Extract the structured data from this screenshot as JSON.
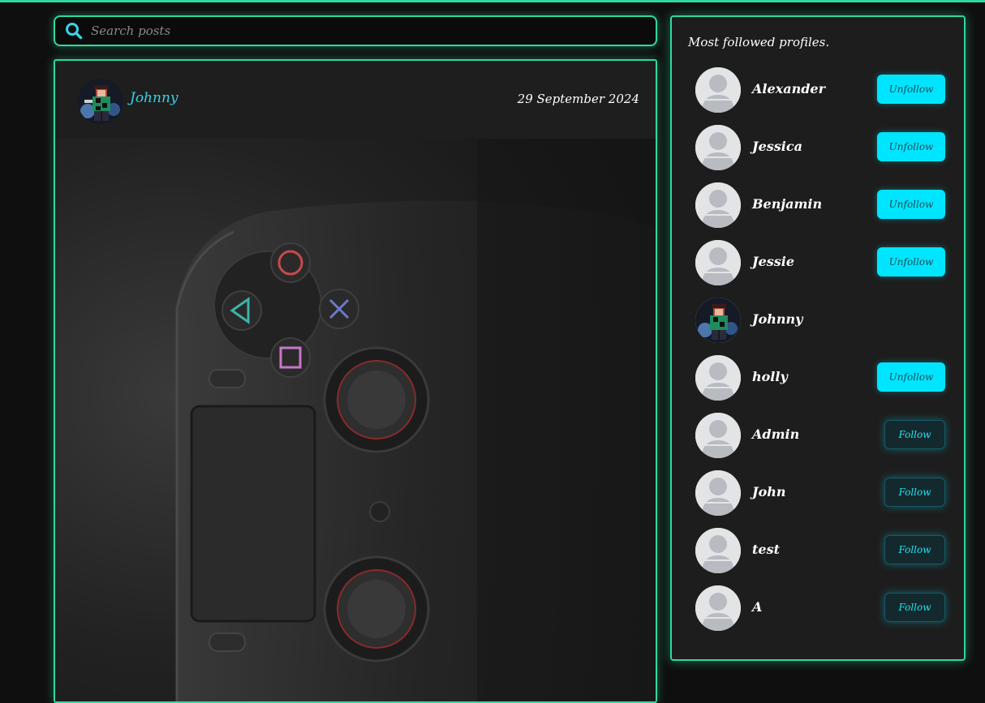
{
  "colors": {
    "accent": "#2ed9a0",
    "link": "#37d4e6",
    "unfollow_bg": "#00e5ff",
    "follow_text": "#22e0ee",
    "background": "#0f0f0f",
    "card": "#1d1d1d"
  },
  "search": {
    "placeholder": "Search posts",
    "icon": "search-icon"
  },
  "post": {
    "author": "Johnny",
    "date": "29 September 2024",
    "image": "game-controller-photo"
  },
  "sidebar": {
    "title": "Most followed profiles.",
    "profiles": [
      {
        "name": "Alexander",
        "action": "Unfollow",
        "avatar": "default-avatar-icon"
      },
      {
        "name": "Jessica",
        "action": "Unfollow",
        "avatar": "default-avatar-icon"
      },
      {
        "name": "Benjamin",
        "action": "Unfollow",
        "avatar": "default-avatar-icon"
      },
      {
        "name": "Jessie",
        "action": "Unfollow",
        "avatar": "default-avatar-icon"
      },
      {
        "name": "Johnny",
        "action": "",
        "avatar": "custom-avatar"
      },
      {
        "name": "holly",
        "action": "Unfollow",
        "avatar": "default-avatar-icon"
      },
      {
        "name": "Admin",
        "action": "Follow",
        "avatar": "default-avatar-icon"
      },
      {
        "name": "John",
        "action": "Follow",
        "avatar": "default-avatar-icon"
      },
      {
        "name": "test",
        "action": "Follow",
        "avatar": "default-avatar-icon"
      },
      {
        "name": "A",
        "action": "Follow",
        "avatar": "default-avatar-icon"
      }
    ]
  }
}
